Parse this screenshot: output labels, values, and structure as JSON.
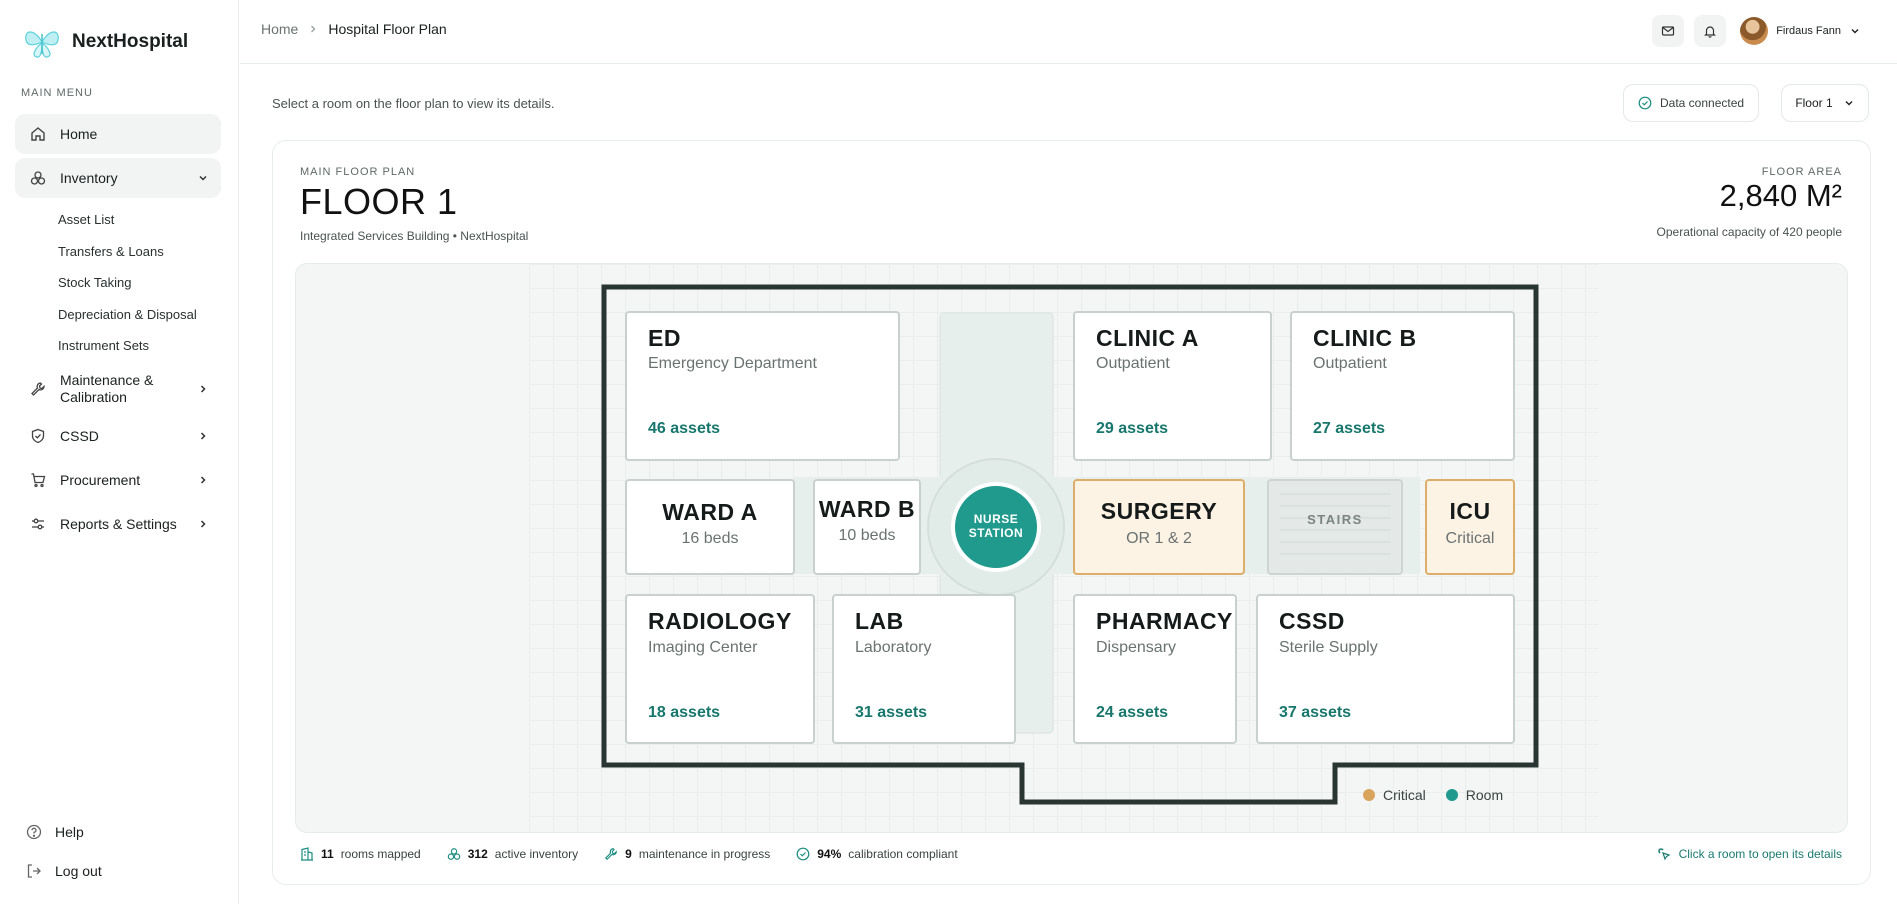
{
  "brand": {
    "name": "NextHospital"
  },
  "sidebar": {
    "menu_label": "MAIN MENU",
    "items": [
      {
        "label": "Home",
        "icon": "home-icon"
      },
      {
        "label": "Inventory",
        "icon": "inventory-icon"
      },
      {
        "label": "Maintenance & Calibration",
        "icon": "wrench-icon"
      },
      {
        "label": "CSSD",
        "icon": "shield-icon"
      },
      {
        "label": "Procurement",
        "icon": "cart-icon"
      },
      {
        "label": "Reports & Settings",
        "icon": "settings-icon"
      }
    ],
    "inventory_sub": [
      "Asset List",
      "Transfers & Loans",
      "Stock Taking",
      "Depreciation & Disposal",
      "Instrument Sets"
    ],
    "bottom": [
      {
        "label": "Help",
        "icon": "help-icon"
      },
      {
        "label": "Log out",
        "icon": "logout-icon"
      }
    ]
  },
  "topbar": {
    "breadcrumb_home": "Home",
    "breadcrumb_current": "Hospital Floor Plan",
    "user_name": "Firdaus Fann"
  },
  "subheader": {
    "hint": "Select a room on the floor plan to view its details.",
    "status": "Data connected",
    "floor_selected": "Floor 1"
  },
  "card": {
    "kicker": "MAIN FLOOR PLAN",
    "title": "FLOOR 1",
    "subtitle": "Integrated Services Building • NextHospital",
    "area_kicker": "FLOOR AREA",
    "area_value": "2,840 M²",
    "area_sub": "Operational capacity of 420 people"
  },
  "rooms": {
    "ed": {
      "name": "ED",
      "sub": "Emergency Department",
      "assets": "46 assets"
    },
    "clinic_a": {
      "name": "CLINIC A",
      "sub": "Outpatient",
      "assets": "29 assets"
    },
    "clinic_b": {
      "name": "CLINIC B",
      "sub": "Outpatient",
      "assets": "27 assets"
    },
    "ward_a": {
      "name": "WARD A",
      "sub": "16 beds"
    },
    "ward_b": {
      "name": "WARD B",
      "sub": "10 beds"
    },
    "nurse": {
      "line1": "NURSE",
      "line2": "STATION"
    },
    "surgery": {
      "name": "SURGERY",
      "sub": "OR 1 & 2"
    },
    "stairs": {
      "name": "STAIRS"
    },
    "icu": {
      "name": "ICU",
      "sub": "Critical"
    },
    "radiology": {
      "name": "RADIOLOGY",
      "sub": "Imaging Center",
      "assets": "18 assets"
    },
    "lab": {
      "name": "LAB",
      "sub": "Laboratory",
      "assets": "31 assets"
    },
    "pharmacy": {
      "name": "PHARMACY",
      "sub": "Dispensary",
      "assets": "24 assets"
    },
    "cssd": {
      "name": "CSSD",
      "sub": "Sterile Supply",
      "assets": "37 assets"
    }
  },
  "legend": {
    "critical": "Critical",
    "room": "Room",
    "critical_color": "#d9a55c",
    "room_color": "#1f9a8c"
  },
  "stats": {
    "rooms_count": "11",
    "rooms_label": "rooms mapped",
    "inventory_count": "312",
    "inventory_label": "active inventory",
    "maintenance_count": "9",
    "maintenance_label": "maintenance in progress",
    "calibration_count": "94%",
    "calibration_label": "calibration compliant",
    "click_hint": "Click a room to open its details"
  }
}
